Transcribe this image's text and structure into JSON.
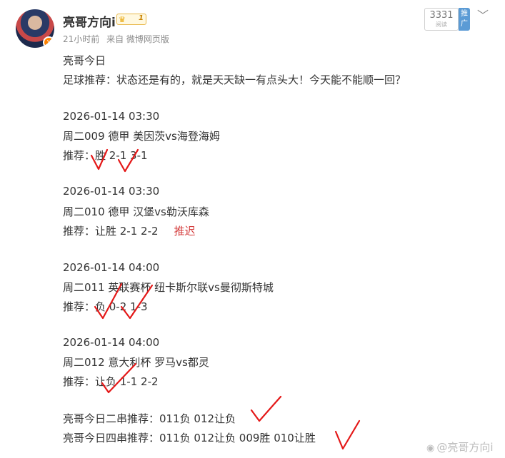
{
  "header": {
    "username": "亮哥方向i",
    "vip_level": "1",
    "time": "21小时前",
    "source": "来自 微博网页版",
    "read_count": "3331",
    "read_label": "阅读",
    "promo_label": "推广"
  },
  "post": {
    "intro": [
      "亮哥今日",
      "足球推荐：状态还是有的，就是天天缺一有点头大！今天能不能顺一回？"
    ],
    "matches": [
      {
        "datetime": "2026-01-14 03:30",
        "match": "周二009 德甲 美因茨vs海登海姆",
        "pick": "推荐：胜 2-1 3-1",
        "status": ""
      },
      {
        "datetime": "2026-01-14 03:30",
        "match": "周二010 德甲 汉堡vs勒沃库森",
        "pick": "推荐：让胜 2-1 2-2",
        "status": "推迟"
      },
      {
        "datetime": "2026-01-14 04:00",
        "match": "周二011 英联赛杯 纽卡斯尔联vs曼彻斯特城",
        "pick": "推荐：负 0-2 1-3",
        "status": ""
      },
      {
        "datetime": "2026-01-14 04:00",
        "match": "周二012 意大利杯 罗马vs都灵",
        "pick": "推荐：让负 1-1 2-2",
        "status": ""
      }
    ],
    "parlay2": "亮哥今日二串推荐：011负 012让负",
    "parlay4": "亮哥今日四串推荐：011负 012让负 009胜 010让胜"
  },
  "watermark": "@亮哥方向i",
  "colors": {
    "mark": "#e41818",
    "postponed": "#d43c3c",
    "meta": "#8a8a8a"
  }
}
